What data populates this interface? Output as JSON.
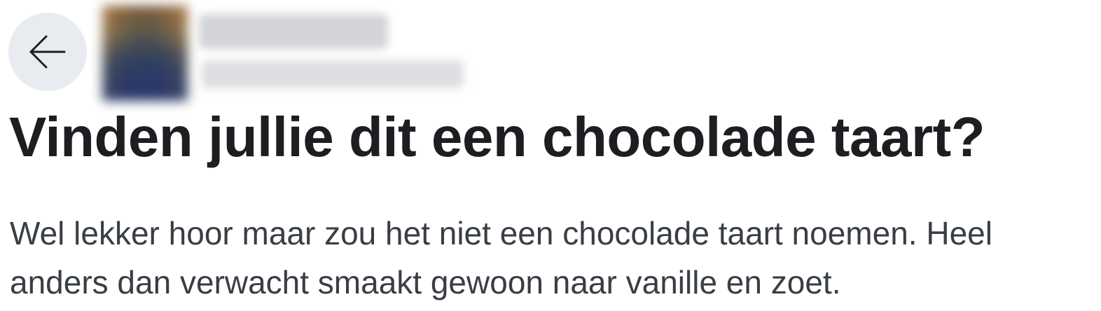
{
  "post": {
    "title": "Vinden jullie dit een chocolade taart?",
    "body": "Wel lekker hoor maar zou het niet een chocolade taart noemen. Heel anders dan verwacht smaakt gewoon naar vanille en zoet."
  },
  "icons": {
    "back": "arrow-left-icon"
  },
  "colors": {
    "back_button_bg": "#e8ecf0",
    "title_text": "#1c1e21",
    "body_text": "#393e45"
  }
}
